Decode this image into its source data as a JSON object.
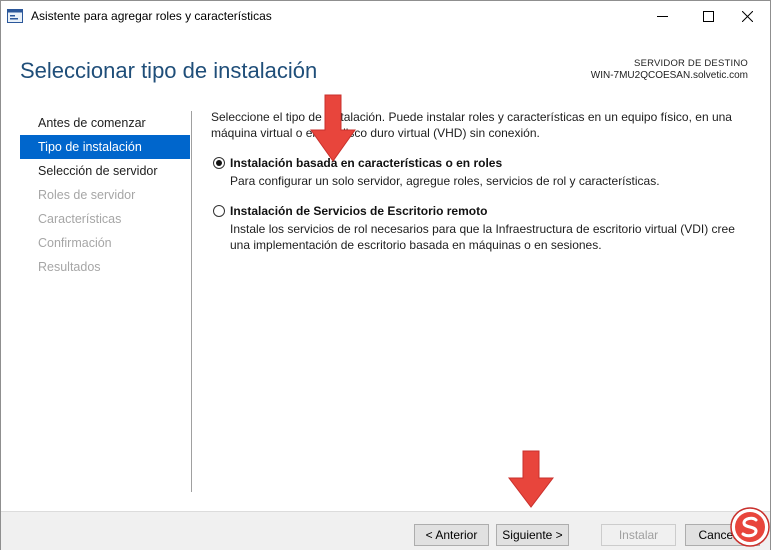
{
  "window": {
    "title": "Asistente para agregar roles y características",
    "controls": [
      "minimize-icon",
      "maximize-icon",
      "close-icon"
    ]
  },
  "header": {
    "title": "Seleccionar tipo de instalación",
    "destination_label": "SERVIDOR DE DESTINO",
    "destination_server": "WIN-7MU2QCOESAN.solvetic.com"
  },
  "nav": {
    "items": [
      {
        "label": "Antes de comenzar",
        "state": "normal"
      },
      {
        "label": "Tipo de instalación",
        "state": "active"
      },
      {
        "label": "Selección de servidor",
        "state": "normal"
      },
      {
        "label": "Roles de servidor",
        "state": "disabled"
      },
      {
        "label": "Características",
        "state": "disabled"
      },
      {
        "label": "Confirmación",
        "state": "disabled"
      },
      {
        "label": "Resultados",
        "state": "disabled"
      }
    ]
  },
  "content": {
    "intro": "Seleccione el tipo de instalación. Puede instalar roles y características en un equipo físico, en una máquina virtual o en un disco duro virtual (VHD) sin conexión.",
    "options": [
      {
        "title": "Instalación basada en características o en roles",
        "description": "Para configurar un solo servidor, agregue roles, servicios de rol y características.",
        "selected": true
      },
      {
        "title": "Instalación de Servicios de Escritorio remoto",
        "description": "Instale los servicios de rol necesarios para que la Infraestructura de escritorio virtual (VDI) cree una implementación de escritorio basada en máquinas o en sesiones.",
        "selected": false
      }
    ]
  },
  "footer": {
    "prev_label": "< Anterior",
    "next_label": "Siguiente >",
    "install_label": "Instalar",
    "cancel_label": "Cancelar"
  },
  "colors": {
    "accent": "#0066cc",
    "title_blue": "#1f4e79",
    "annotation_arrow": "#e8453c"
  }
}
